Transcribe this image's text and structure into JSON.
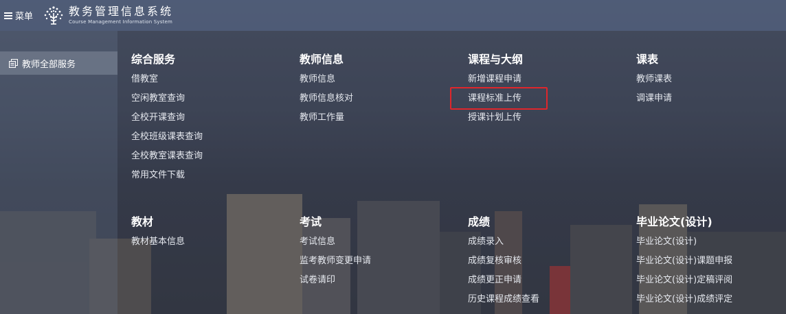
{
  "header": {
    "menu_label": "菜单",
    "brand_title": "教务管理信息系统",
    "brand_subtitle": "Course Management Information System"
  },
  "sidebar": {
    "items": [
      {
        "label": "教师全部服务",
        "icon": "copy-pages-icon"
      }
    ]
  },
  "sections": [
    {
      "title": "综合服务",
      "items": [
        "借教室",
        "空闲教室查询",
        "全校开课查询",
        "全校班级课表查询",
        "全校教室课表查询",
        "常用文件下载"
      ]
    },
    {
      "title": "教师信息",
      "items": [
        "教师信息",
        "教师信息核对",
        "教师工作量"
      ]
    },
    {
      "title": "课程与大纲",
      "items": [
        "新增课程申请",
        "课程标准上传",
        "授课计划上传"
      ]
    },
    {
      "title": "课表",
      "items": [
        "教师课表",
        "调课申请"
      ]
    },
    {
      "title": "教材",
      "items": [
        "教材基本信息"
      ]
    },
    {
      "title": "考试",
      "items": [
        "考试信息",
        "监考教师变更申请",
        "试卷请印"
      ]
    },
    {
      "title": "成绩",
      "items": [
        "成绩录入",
        "成绩复核审核",
        "成绩更正申请",
        "历史课程成绩查看"
      ]
    },
    {
      "title": "毕业论文(设计)",
      "items": [
        "毕业论文(设计)",
        "毕业论文(设计)课题申报",
        "毕业论文(设计)定稿评阅",
        "毕业论文(设计)成绩评定"
      ]
    }
  ],
  "highlight": {
    "section": "课程与大纲",
    "item": "课程标准上传",
    "color": "#e0262b"
  }
}
